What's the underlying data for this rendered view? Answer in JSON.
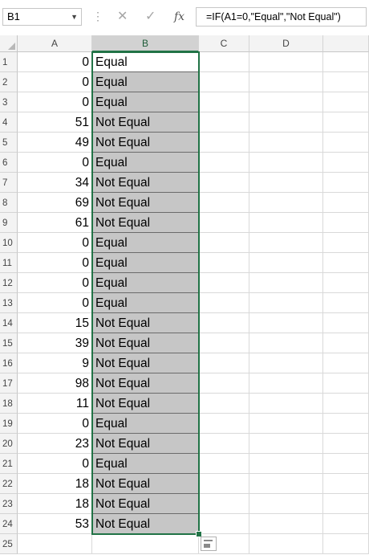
{
  "namebox": {
    "value": "B1"
  },
  "toolbar": {
    "cancel_glyph": "✕",
    "enter_glyph": "✓",
    "fx_glyph": "fx"
  },
  "formula": {
    "value": "=IF(A1=0,\"Equal\",\"Not Equal\")"
  },
  "columns": [
    "A",
    "B",
    "C",
    "D"
  ],
  "selected_column": "B",
  "rows": [
    {
      "n": "1",
      "a": "0",
      "b": "Equal"
    },
    {
      "n": "2",
      "a": "0",
      "b": "Equal"
    },
    {
      "n": "3",
      "a": "0",
      "b": "Equal"
    },
    {
      "n": "4",
      "a": "51",
      "b": "Not Equal"
    },
    {
      "n": "5",
      "a": "49",
      "b": "Not Equal"
    },
    {
      "n": "6",
      "a": "0",
      "b": "Equal"
    },
    {
      "n": "7",
      "a": "34",
      "b": "Not Equal"
    },
    {
      "n": "8",
      "a": "69",
      "b": "Not Equal"
    },
    {
      "n": "9",
      "a": "61",
      "b": "Not Equal"
    },
    {
      "n": "10",
      "a": "0",
      "b": "Equal"
    },
    {
      "n": "11",
      "a": "0",
      "b": "Equal"
    },
    {
      "n": "12",
      "a": "0",
      "b": "Equal"
    },
    {
      "n": "13",
      "a": "0",
      "b": "Equal"
    },
    {
      "n": "14",
      "a": "15",
      "b": "Not Equal"
    },
    {
      "n": "15",
      "a": "39",
      "b": "Not Equal"
    },
    {
      "n": "16",
      "a": "9",
      "b": "Not Equal"
    },
    {
      "n": "17",
      "a": "98",
      "b": "Not Equal"
    },
    {
      "n": "18",
      "a": "11",
      "b": "Not Equal"
    },
    {
      "n": "19",
      "a": "0",
      "b": "Equal"
    },
    {
      "n": "20",
      "a": "23",
      "b": "Not Equal"
    },
    {
      "n": "21",
      "a": "0",
      "b": "Equal"
    },
    {
      "n": "22",
      "a": "18",
      "b": "Not Equal"
    },
    {
      "n": "23",
      "a": "18",
      "b": "Not Equal"
    },
    {
      "n": "24",
      "a": "53",
      "b": "Not Equal"
    },
    {
      "n": "25",
      "a": "",
      "b": ""
    }
  ],
  "colors": {
    "selection": "#217346",
    "fill": "#c6c6c6"
  }
}
